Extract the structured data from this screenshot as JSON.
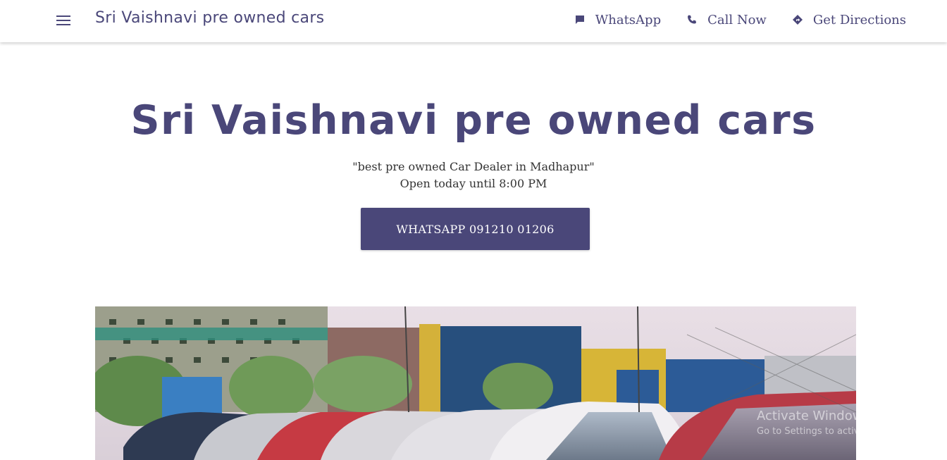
{
  "header": {
    "brand": "Sri Vaishnavi pre owned cars",
    "nav": [
      {
        "label": "WhatsApp",
        "icon": "chat-icon"
      },
      {
        "label": "Call Now",
        "icon": "phone-icon"
      },
      {
        "label": "Get Directions",
        "icon": "directions-icon"
      }
    ]
  },
  "hero": {
    "title": "Sri Vaishnavi pre owned cars",
    "tagline": "\"best pre owned Car Dealer in Madhapur\"",
    "hours": "Open today until 8:00 PM",
    "cta_label": "WHATSAPP 091210 01206"
  },
  "watermark": {
    "line1": "Activate Windows",
    "line2": "Go to Settings to activate Windows."
  },
  "colors": {
    "brand": "#4a4779",
    "background": "#ffffff"
  }
}
